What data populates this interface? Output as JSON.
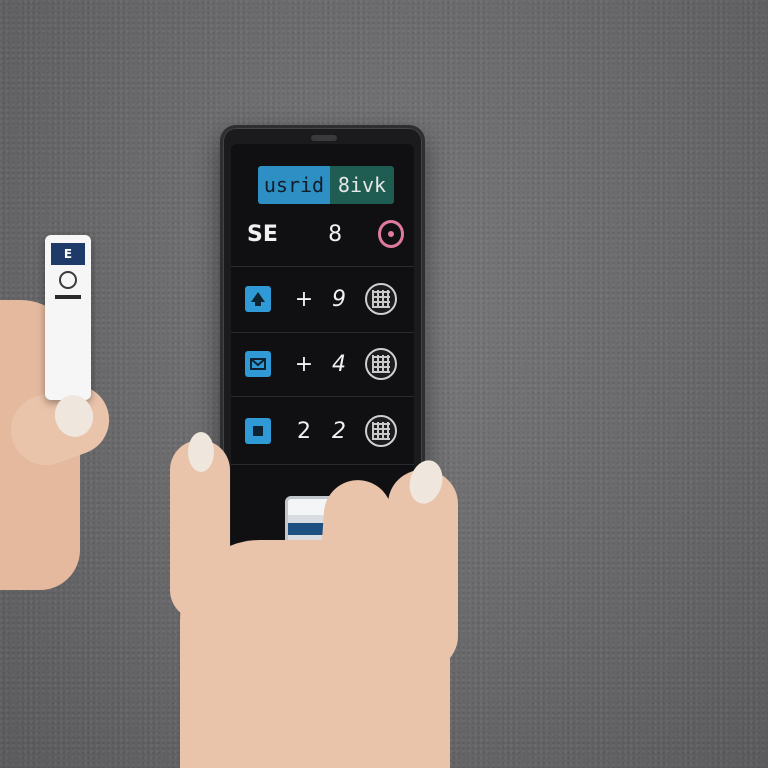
{
  "phone": {
    "header_left": "usrid",
    "header_right": "8ivk",
    "brand": "SE",
    "top_number": "8",
    "rows": [
      {
        "icon": "arrow-up-icon",
        "op": "+",
        "value": "9"
      },
      {
        "icon": "mail-icon",
        "op": "+",
        "value": "4"
      },
      {
        "icon": "box-icon",
        "op": "2",
        "value": "2"
      }
    ]
  },
  "remote": {
    "label": "E"
  },
  "colors": {
    "accent_blue": "#2f9ad6",
    "header_teal": "#1f5c52",
    "ring_pink": "#e07aa0",
    "background_gray": "#6a6a6c"
  }
}
